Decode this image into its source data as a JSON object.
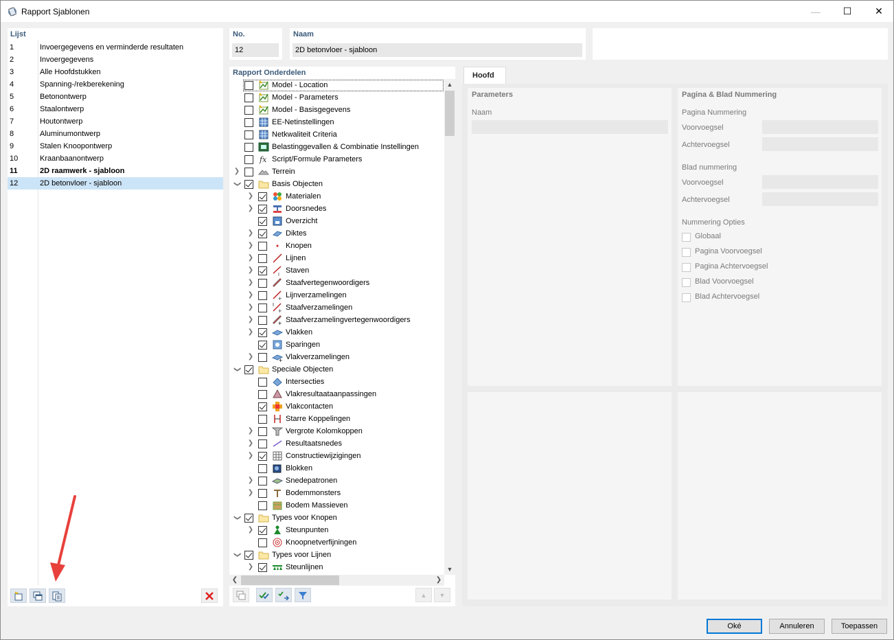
{
  "window": {
    "title": "Rapport Sjablonen",
    "minimize": "—",
    "maximize": "☐",
    "close": "✕"
  },
  "list": {
    "header": "Lijst",
    "items": [
      {
        "no": "1",
        "label": "Invoergegevens en verminderde resultaten"
      },
      {
        "no": "2",
        "label": "Invoergegevens"
      },
      {
        "no": "3",
        "label": "Alle Hoofdstukken"
      },
      {
        "no": "4",
        "label": "Spanning-/rekberekening"
      },
      {
        "no": "5",
        "label": "Betonontwerp"
      },
      {
        "no": "6",
        "label": "Staalontwerp"
      },
      {
        "no": "7",
        "label": "Houtontwerp"
      },
      {
        "no": "8",
        "label": "Aluminumontwerp"
      },
      {
        "no": "9",
        "label": "Stalen Knoopontwerp"
      },
      {
        "no": "10",
        "label": "Kraanbaanontwerp"
      },
      {
        "no": "11",
        "label": "2D raamwerk - sjabloon"
      },
      {
        "no": "12",
        "label": "2D betonvloer - sjabloon"
      }
    ]
  },
  "no_field": {
    "label": "No.",
    "value": "12"
  },
  "name_field": {
    "label": "Naam",
    "value": "2D betonvloer - sjabloon"
  },
  "tree": {
    "header": "Rapport Onderdelen",
    "items": [
      {
        "label": "Model - Location",
        "checked": false,
        "level": 0,
        "expand": "",
        "icon": "model-icon"
      },
      {
        "label": "Model - Parameters",
        "checked": false,
        "level": 0,
        "expand": "",
        "icon": "model-icon"
      },
      {
        "label": "Model - Basisgegevens",
        "checked": false,
        "level": 0,
        "expand": "",
        "icon": "model-icon"
      },
      {
        "label": "EE-Netinstellingen",
        "checked": false,
        "level": 0,
        "expand": "",
        "icon": "mesh-icon"
      },
      {
        "label": "Netkwaliteit Criteria",
        "checked": false,
        "level": 0,
        "expand": "",
        "icon": "mesh-icon"
      },
      {
        "label": "Belastinggevallen & Combinatie Instellingen",
        "checked": false,
        "level": 0,
        "expand": "",
        "icon": "load-icon"
      },
      {
        "label": "Script/Formule Parameters",
        "checked": false,
        "level": 0,
        "expand": "",
        "icon": "formula-icon"
      },
      {
        "label": "Terrein",
        "checked": false,
        "level": 0,
        "expand": ">",
        "icon": "terrain-icon"
      },
      {
        "label": "Basis Objecten",
        "checked": true,
        "level": 0,
        "expand": "v",
        "icon": "folder-icon"
      },
      {
        "label": "Materialen",
        "checked": true,
        "level": 1,
        "expand": ">",
        "icon": "material-icon"
      },
      {
        "label": "Doorsnedes",
        "checked": true,
        "level": 1,
        "expand": ">",
        "icon": "section-icon"
      },
      {
        "label": "Overzicht",
        "checked": true,
        "level": 1,
        "expand": "",
        "icon": "overview-icon"
      },
      {
        "label": "Diktes",
        "checked": true,
        "level": 1,
        "expand": ">",
        "icon": "thickness-icon"
      },
      {
        "label": "Knopen",
        "checked": false,
        "level": 1,
        "expand": ">",
        "icon": "node-icon"
      },
      {
        "label": "Lijnen",
        "checked": false,
        "level": 1,
        "expand": ">",
        "icon": "line-icon"
      },
      {
        "label": "Staven",
        "checked": true,
        "level": 1,
        "expand": ">",
        "icon": "member-icon"
      },
      {
        "label": "Staafvertegenwoordigers",
        "checked": false,
        "level": 1,
        "expand": ">",
        "icon": "member-rep-icon"
      },
      {
        "label": "Lijnverzamelingen",
        "checked": false,
        "level": 1,
        "expand": ">",
        "icon": "line-set-icon"
      },
      {
        "label": "Staafverzamelingen",
        "checked": false,
        "level": 1,
        "expand": ">",
        "icon": "member-set-icon"
      },
      {
        "label": "Staafverzamelingvertegenwoordigers",
        "checked": false,
        "level": 1,
        "expand": ">",
        "icon": "member-set-rep-icon"
      },
      {
        "label": "Vlakken",
        "checked": true,
        "level": 1,
        "expand": ">",
        "icon": "surface-icon"
      },
      {
        "label": "Sparingen",
        "checked": true,
        "level": 1,
        "expand": "",
        "icon": "opening-icon"
      },
      {
        "label": "Vlakverzamelingen",
        "checked": false,
        "level": 1,
        "expand": ">",
        "icon": "surface-set-icon"
      },
      {
        "label": "Speciale Objecten",
        "checked": true,
        "level": 0,
        "expand": "v",
        "icon": "folder-icon"
      },
      {
        "label": "Intersecties",
        "checked": false,
        "level": 1,
        "expand": "",
        "icon": "intersection-icon"
      },
      {
        "label": "Vlakresultaataanpassingen",
        "checked": false,
        "level": 1,
        "expand": "",
        "icon": "result-adjust-icon"
      },
      {
        "label": "Vlakcontacten",
        "checked": true,
        "level": 1,
        "expand": "",
        "icon": "contact-icon"
      },
      {
        "label": "Starre Koppelingen",
        "checked": false,
        "level": 1,
        "expand": "",
        "icon": "rigid-link-icon"
      },
      {
        "label": "Vergrote Kolomkoppen",
        "checked": false,
        "level": 1,
        "expand": ">",
        "icon": "column-head-icon"
      },
      {
        "label": "Resultaatsnedes",
        "checked": false,
        "level": 1,
        "expand": ">",
        "icon": "result-section-icon"
      },
      {
        "label": "Constructiewijzigingen",
        "checked": true,
        "level": 1,
        "expand": ">",
        "icon": "modification-icon"
      },
      {
        "label": "Blokken",
        "checked": false,
        "level": 1,
        "expand": "",
        "icon": "block-icon"
      },
      {
        "label": "Snedepatronen",
        "checked": false,
        "level": 1,
        "expand": ">",
        "icon": "cutting-pattern-icon"
      },
      {
        "label": "Bodemmonsters",
        "checked": false,
        "level": 1,
        "expand": ">",
        "icon": "soil-sample-icon"
      },
      {
        "label": "Bodem Massieven",
        "checked": false,
        "level": 1,
        "expand": "",
        "icon": "soil-massive-icon"
      },
      {
        "label": "Types voor Knopen",
        "checked": true,
        "level": 0,
        "expand": "v",
        "icon": "folder-icon"
      },
      {
        "label": "Steunpunten",
        "checked": true,
        "level": 1,
        "expand": ">",
        "icon": "support-icon"
      },
      {
        "label": "Knoopnetverfijningen",
        "checked": false,
        "level": 1,
        "expand": "",
        "icon": "refinement-icon"
      },
      {
        "label": "Types voor Lijnen",
        "checked": true,
        "level": 0,
        "expand": "v",
        "icon": "folder-icon"
      },
      {
        "label": "Steunlijnen",
        "checked": true,
        "level": 1,
        "expand": ">",
        "icon": "line-support-icon"
      }
    ]
  },
  "tab": {
    "label": "Hoofd"
  },
  "params": {
    "header": "Parameters",
    "name_label": "Naam"
  },
  "paging": {
    "header": "Pagina & Blad Nummering",
    "page_numbering": "Pagina Nummering",
    "prefix": "Voorvoegsel",
    "suffix": "Achtervoegsel",
    "sheet_numbering": "Blad nummering",
    "prefix2": "Voorvoegsel",
    "suffix2": "Achtervoegsel",
    "options_header": "Nummering Opties",
    "options": [
      "Globaal",
      "Pagina Voorvoegsel",
      "Pagina Achtervoegsel",
      "Blad Voorvoegsel",
      "Blad Achtervoegsel"
    ]
  },
  "buttons": {
    "ok": "Oké",
    "cancel": "Annuleren",
    "apply": "Toepassen"
  },
  "colors": {
    "accent": "#0078d7",
    "selection": "#cce4f7",
    "header_text": "#3b5a7a",
    "arrow": "#e8413c"
  }
}
